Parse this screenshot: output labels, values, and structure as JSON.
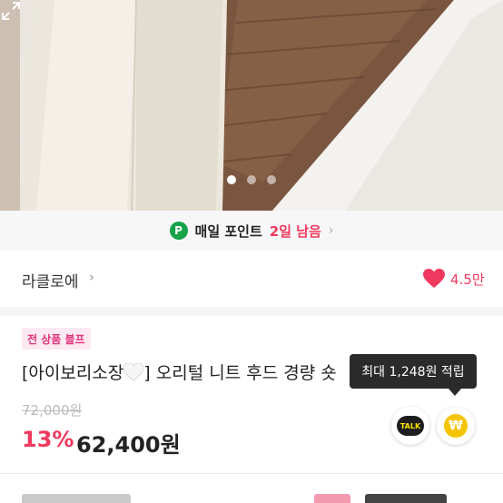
{
  "carousel": {
    "total_slides": 3,
    "active_slide": 1,
    "expand_icon": "expand-icon"
  },
  "point_banner": {
    "badge": "P",
    "label": "매일 포인트",
    "days_left": "2일 남음",
    "chevron": "›"
  },
  "seller": {
    "name": "라클로에",
    "chevron": "›",
    "like_count": "4.5만",
    "heart_color": "#f0395e"
  },
  "product": {
    "promo_badge": "전 상품 블프",
    "title_prefix": "[아이보리소장",
    "title_suffix": "] 오리털 니트 후드 경량 숏",
    "original_price": "72,000원",
    "discount": "13%",
    "price": "62,400원"
  },
  "tooltip": {
    "text": "최대 1,248원 적립"
  },
  "actions": {
    "talk_label": "TALK",
    "won_symbol": "₩"
  },
  "colors": {
    "accent": "#f0395e",
    "point_green": "#16a34a",
    "coin": "#f5c400"
  }
}
